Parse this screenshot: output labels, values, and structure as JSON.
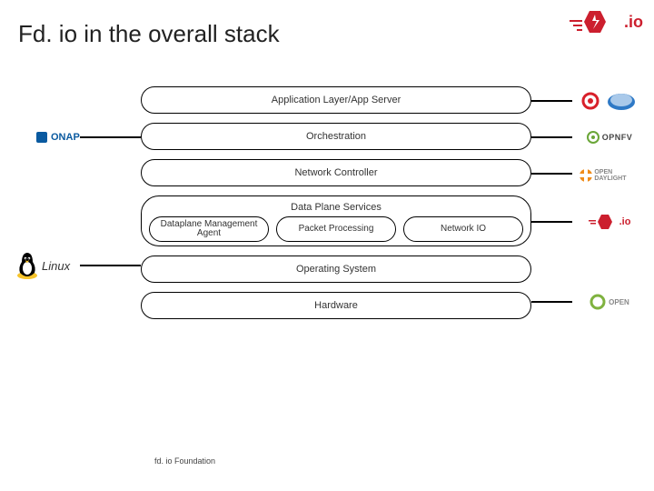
{
  "header": {
    "title": "Fd. io in the overall stack"
  },
  "top_logo": {
    "suffix": ".io"
  },
  "stack": {
    "layers": [
      {
        "label": "Application Layer/App Server"
      },
      {
        "label": "Orchestration"
      },
      {
        "label": "Network Controller"
      },
      {
        "label": "Data Plane Services",
        "sublayers": [
          {
            "label": "Dataplane Management Agent"
          },
          {
            "label": "Packet Processing"
          },
          {
            "label": "Network IO"
          }
        ]
      },
      {
        "label": "Operating System"
      },
      {
        "label": "Hardware"
      }
    ]
  },
  "right_logos": {
    "app": {
      "name": "openshift-cloudfoundry"
    },
    "orch": {
      "name": "opnfv",
      "text": "OPNFV"
    },
    "controller": {
      "name": "opendaylight",
      "text": "OPEN DAYLIGHT"
    },
    "dataplane": {
      "name": "fdio",
      "suffix": ".io"
    },
    "hardware": {
      "name": "opencompute",
      "text": "OPEN"
    }
  },
  "left_logos": {
    "orch": {
      "name": "onap",
      "text": "ONAP"
    },
    "os": {
      "name": "linux",
      "text": "Linux"
    }
  },
  "footer": {
    "text": "fd. io Foundation"
  },
  "colors": {
    "accent_red": "#cc1f2e",
    "onap_blue": "#0a5aa0",
    "opnfv_green": "#6aa638",
    "daylight_orange": "#f08c1a"
  }
}
